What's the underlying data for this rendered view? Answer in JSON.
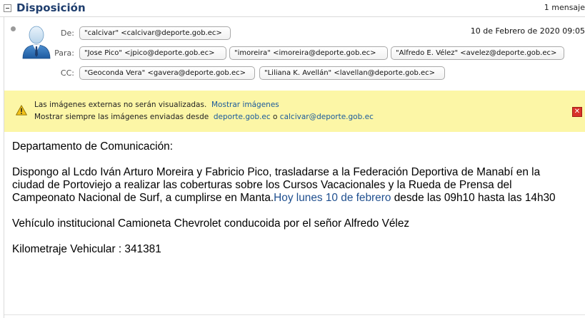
{
  "thread": {
    "title": "Disposición",
    "count_label": "1 mensaje"
  },
  "message": {
    "date": "10 de Febrero de 2020 09:05",
    "from_label": "De:",
    "to_label": "Para:",
    "cc_label": "CC:",
    "from": [
      "\"calcivar\" <calcivar@deporte.gob.ec>"
    ],
    "to": [
      "\"Jose Pico\" <jpico@deporte.gob.ec>",
      "\"imoreira\" <imoreira@deporte.gob.ec>",
      "\"Alfredo E. Vélez\" <avelez@deporte.gob.ec>"
    ],
    "cc": [
      "\"Geoconda Vera\" <gavera@deporte.gob.ec>",
      "\"Liliana K. Avellán\" <lavellan@deporte.gob.ec>"
    ]
  },
  "notice": {
    "text1": "Las imágenes externas no serán visualizadas.",
    "show_images": "Mostrar imágenes",
    "text2": "Mostrar siempre las imágenes enviadas desde",
    "domain_link": "deporte.gob.ec",
    "or": "o",
    "sender_link": "calcivar@deporte.gob.ec",
    "close_glyph": "✕"
  },
  "body": {
    "greeting": "Departamento de Comunicación:",
    "p1_line1": "Dispongo al Lcdo Iván Arturo Moreira y Fabricio Pico, trasladarse a la Federación Deportiva de Manabí en la",
    "p1_line2": "ciudad de Portoviejo a realizar las coberturas sobre los Cursos Vacacionales  y la Rueda de Prensa del",
    "p1_line3_a": "Campeonato Nacional de Surf, a cumplirse en Manta.",
    "p1_line3_link": "Hoy lunes 10 de febrero",
    "p1_line3_b": " desde las 09h10 hasta las 14h30",
    "vehicle": "Vehículo institucional  Camioneta Chevrolet conducoida por el señor Alfredo Vélez",
    "mileage": "Kilometraje Vehicular : 341381"
  },
  "icons": {
    "collapse": "collapse-icon",
    "avatar": "user-avatar-icon",
    "warning": "warning-icon",
    "close": "close-icon"
  },
  "colors": {
    "title": "#1f3e6e",
    "link": "#1a5a9c",
    "notice_bg": "#fcf6a6",
    "close_bg": "#d8322a"
  }
}
